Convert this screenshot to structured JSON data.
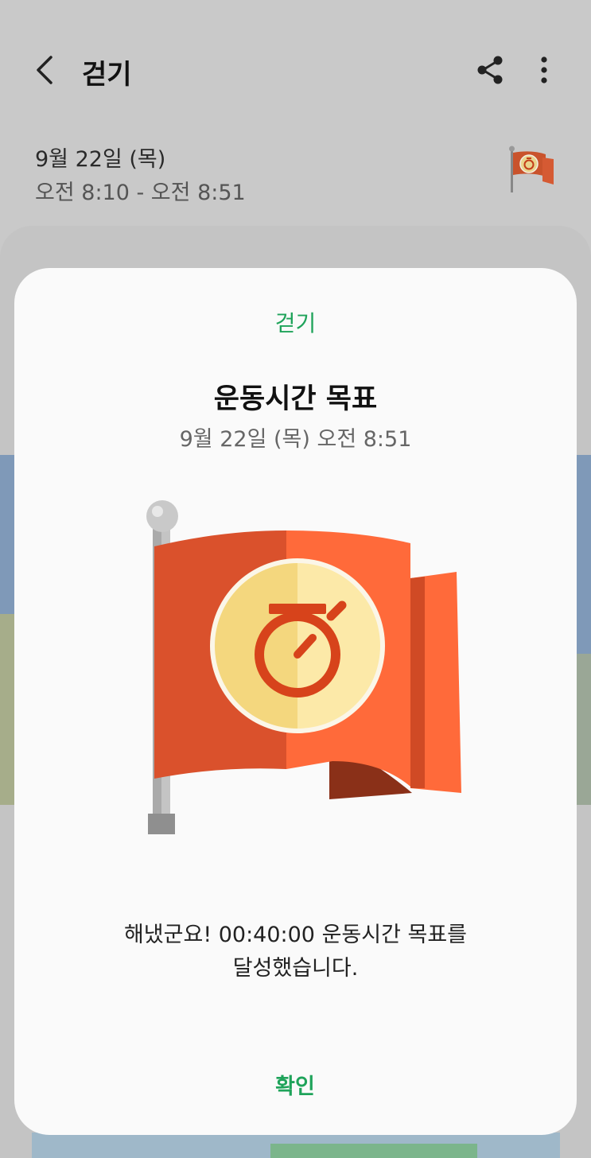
{
  "appbar": {
    "title": "걷기",
    "back_icon": "chevron-left-icon",
    "share_icon": "share-icon",
    "more_icon": "more-vertical-icon"
  },
  "session": {
    "date": "9월 22일 (목)",
    "time_range": "오전 8:10 - 오전 8:51"
  },
  "dialog": {
    "category": "걷기",
    "title": "운동시간 목표",
    "datetime": "9월 22일 (목) 오전 8:51",
    "message_line1": "해냈군요! 00:40:00 운동시간 목표를",
    "message_line2": "달성했습니다.",
    "confirm_label": "확인",
    "badge_icon": "stopwatch-flag-icon"
  },
  "colors": {
    "accent_green": "#1fa35a",
    "flag_red": "#e0532e",
    "flag_orange": "#ff6a3a",
    "medal_yellow": "#f7e08a",
    "overlay_bg": "#c9c9c9"
  }
}
